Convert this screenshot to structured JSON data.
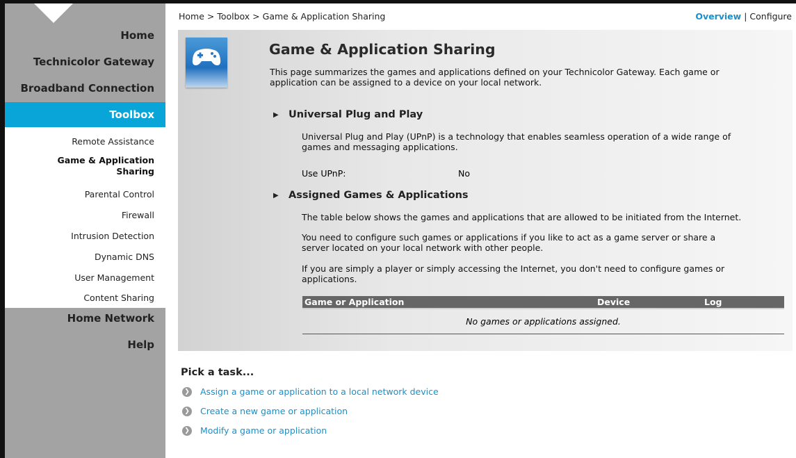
{
  "breadcrumb": "Home > Toolbox > Game & Application Sharing",
  "top_links": {
    "overview": "Overview",
    "separator": "|",
    "configure": "Configure"
  },
  "sidebar": {
    "main_items": [
      "Home",
      "Technicolor Gateway",
      "Broadband Connection"
    ],
    "active": "Toolbox",
    "sub_items": [
      "Remote Assistance",
      "Game & Application",
      "Sharing",
      "Parental Control",
      "Firewall",
      "Intrusion Detection",
      "Dynamic DNS",
      "User Management",
      "Content Sharing"
    ],
    "bottom_items": [
      "Home Network",
      "Help"
    ]
  },
  "page": {
    "icon": "gamepad-icon",
    "title": "Game & Application Sharing",
    "intro_line1": "This page summarizes the games and applications defined on your Technicolor Gateway. Each game or",
    "intro_line2": "application can be assigned to a device on your local network."
  },
  "upnp": {
    "heading": "Universal Plug and Play",
    "desc_line1": "Universal Plug and Play (UPnP) is a technology that enables seamless operation of a wide range of",
    "desc_line2": "games and messaging applications.",
    "label": "Use UPnP:",
    "value": "No"
  },
  "assigned": {
    "heading": "Assigned Games & Applications",
    "p1": "The table below shows the games and applications that are allowed to be initiated from the Internet.",
    "p2_line1": "You need to configure such games or applications if you like to act as a game server or share a",
    "p2_line2": "server located on your local network with other people.",
    "p3_line1": "If you are simply a player or simply accessing the Internet, you don't need to configure games or",
    "p3_line2": "applications.",
    "columns": [
      "Game or Application",
      "Device",
      "Log"
    ],
    "empty": "No games or applications assigned."
  },
  "tasks": {
    "heading": "Pick a task...",
    "items": [
      "Assign a game or application to a local network device",
      "Create a new game or application",
      "Modify a game or application"
    ]
  },
  "colors": {
    "accent": "#0aa5d8",
    "link": "#1a8fc8",
    "sidebar": "#a3a3a3"
  }
}
